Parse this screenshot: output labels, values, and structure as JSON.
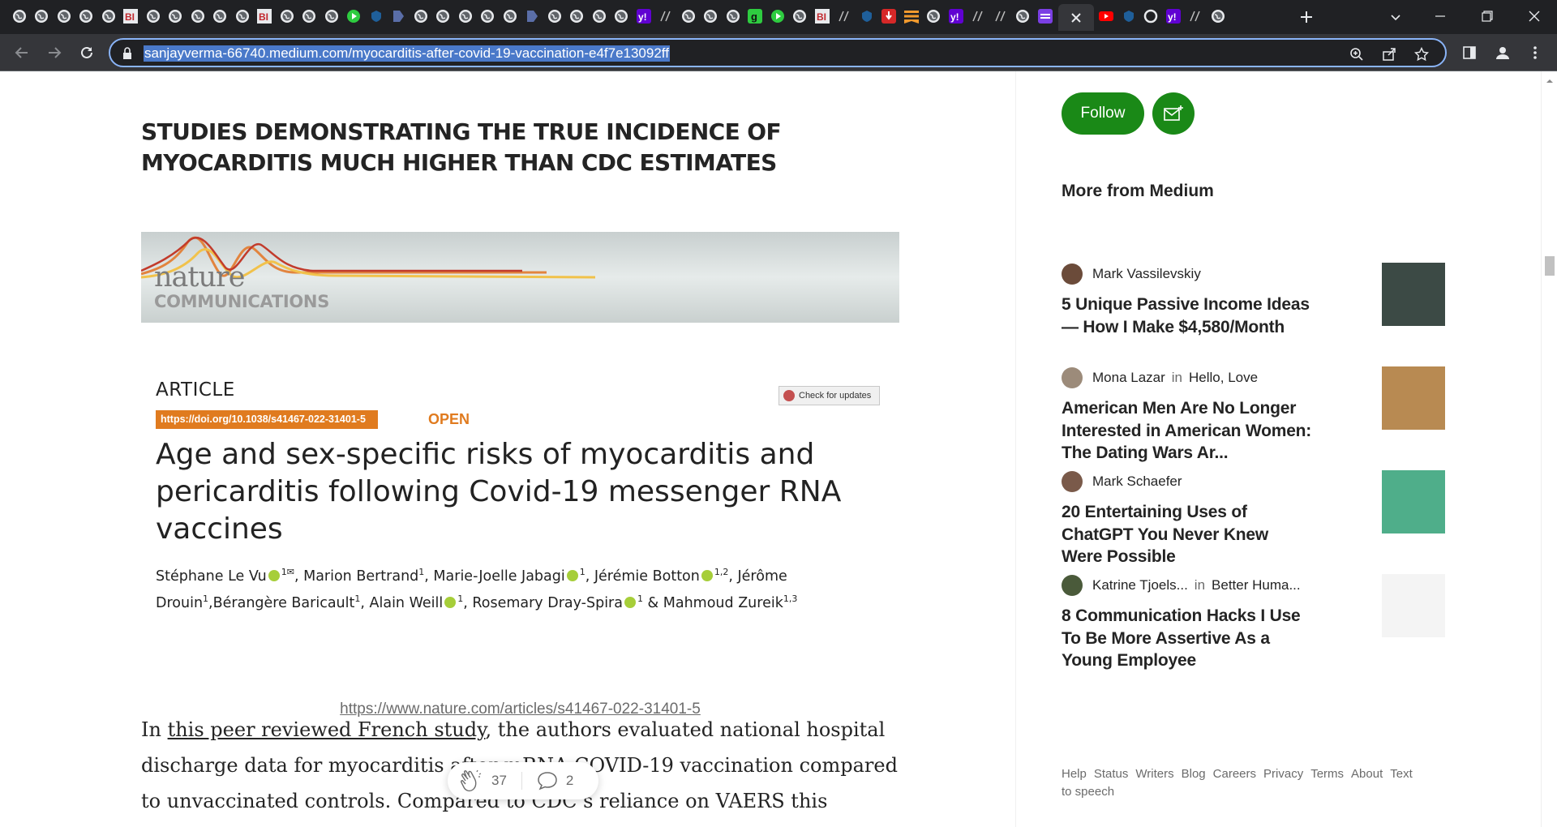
{
  "browser": {
    "url_text": "sanjayverma-66740.medium.com/myocarditis-after-covid-19-vaccination-e4f7e13092ff",
    "tab_icons": [
      "globe-icon",
      "globe-icon",
      "globe-icon",
      "globe-icon",
      "globe-icon",
      "bi-icon",
      "globe-icon",
      "globe-icon",
      "globe-icon",
      "globe-icon",
      "globe-icon",
      "bi-icon",
      "globe-icon",
      "globe-icon",
      "globe-icon",
      "play-icon",
      "shield-icon",
      "bookmark-icon",
      "globe-icon",
      "globe-icon",
      "globe-icon",
      "globe-icon",
      "globe-icon",
      "bookmark-icon",
      "globe-icon",
      "globe-icon",
      "globe-icon",
      "globe-icon",
      "yahoo-icon",
      "slash-icon",
      "globe-icon",
      "globe-icon",
      "globe-icon",
      "g-icon",
      "play-icon",
      "globe-icon",
      "bi-icon",
      "slash-icon",
      "shield-icon",
      "red-icon",
      "stack-icon",
      "globe-icon",
      "yahoo-icon",
      "slash-icon",
      "slash-icon",
      "globe-icon",
      "purple-icon",
      "close-icon",
      "youtube-icon",
      "shield-icon",
      "circle-icon",
      "yahoo-icon",
      "slash-icon",
      "globe-icon"
    ]
  },
  "article": {
    "section_heading": "STUDIES DEMONSTRATING THE TRUE INCIDENCE OF MYOCARDITIS MUCH HIGHER THAN CDC ESTIMATES",
    "banner_word": "nature",
    "banner_sub": "COMMUNICATIONS",
    "label": "ARTICLE",
    "doi": "https://doi.org/10.1038/s41467-022-31401-5",
    "open_label": "OPEN",
    "check_updates": "Check for updates",
    "paper_title": "Age and sex-specific risks of myocarditis and pericarditis following Covid-19 messenger RNA vaccines",
    "authors": [
      {
        "name": "Stéphane Le Vu",
        "orcid": true,
        "sup": "1✉",
        "sep": ", "
      },
      {
        "name": "Marion Bertrand",
        "orcid": false,
        "sup": "1",
        "sep": ", "
      },
      {
        "name": "Marie-Joelle Jabagi",
        "orcid": true,
        "sup": "1",
        "sep": ", "
      },
      {
        "name": "Jérémie Botton",
        "orcid": true,
        "sup": "1,2",
        "sep": ", "
      },
      {
        "name": "Jérôme Drouin",
        "orcid": false,
        "sup": "1",
        "sep": ","
      },
      {
        "name": "Bérangère Baricault",
        "orcid": false,
        "sup": "1",
        "sep": ", "
      },
      {
        "name": "Alain Weill",
        "orcid": true,
        "sup": "1",
        "sep": ", "
      },
      {
        "name": "Rosemary Dray-Spira",
        "orcid": true,
        "sup": "1",
        "sep": " & "
      },
      {
        "name": "Mahmoud Zureik",
        "orcid": false,
        "sup": "1,3",
        "sep": ""
      }
    ],
    "paper_link": "https://www.nature.com/articles/s41467-022-31401-5",
    "body_intro": "In ",
    "body_link": "this peer reviewed French study",
    "body_rest": ", the authors evaluated national hospital discharge data for myocarditis after mRNA COVID-19 vaccination compared to unvaccinated controls. Compared to CDC’s reliance on VAERS this French",
    "claps": "37",
    "responses": "2"
  },
  "sidebar": {
    "follow_label": "Follow",
    "more_heading": "More from Medium",
    "stories": [
      {
        "author": "Mark Vassilevskiy",
        "in": "",
        "publication": "",
        "title": "5 Unique Passive Income Ideas — How I Make $4,580/Month",
        "avatar_color": "#6b4b3a",
        "thumb_color": "#3c4a45"
      },
      {
        "author": "Mona Lazar",
        "in": "in",
        "publication": "Hello, Love",
        "title": "American Men Are No Longer Interested in American Women: The Dating Wars Ar...",
        "avatar_color": "#9c8b7a",
        "thumb_color": "#b88a52"
      },
      {
        "author": "Mark Schaefer",
        "in": "",
        "publication": "",
        "title": "20 Entertaining Uses of ChatGPT You Never Knew Were Possible",
        "avatar_color": "#7a5a4a",
        "thumb_color": "#4fae8a"
      },
      {
        "author": "Katrine Tjoels...",
        "in": "in",
        "publication": "Better Huma...",
        "title": "8 Communication Hacks I Use To Be More Assertive As a Young Employee",
        "avatar_color": "#4a5a3a",
        "thumb_color": "#f4f4f4"
      }
    ],
    "footer_links": [
      "Help",
      "Status",
      "Writers",
      "Blog",
      "Careers",
      "Privacy",
      "Terms",
      "About",
      "Text to speech"
    ]
  },
  "colors": {
    "chrome_dark": "#202124",
    "chrome_toolbar": "#35363a",
    "medium_green": "#1a8917",
    "doi_orange": "#e07b1f"
  }
}
